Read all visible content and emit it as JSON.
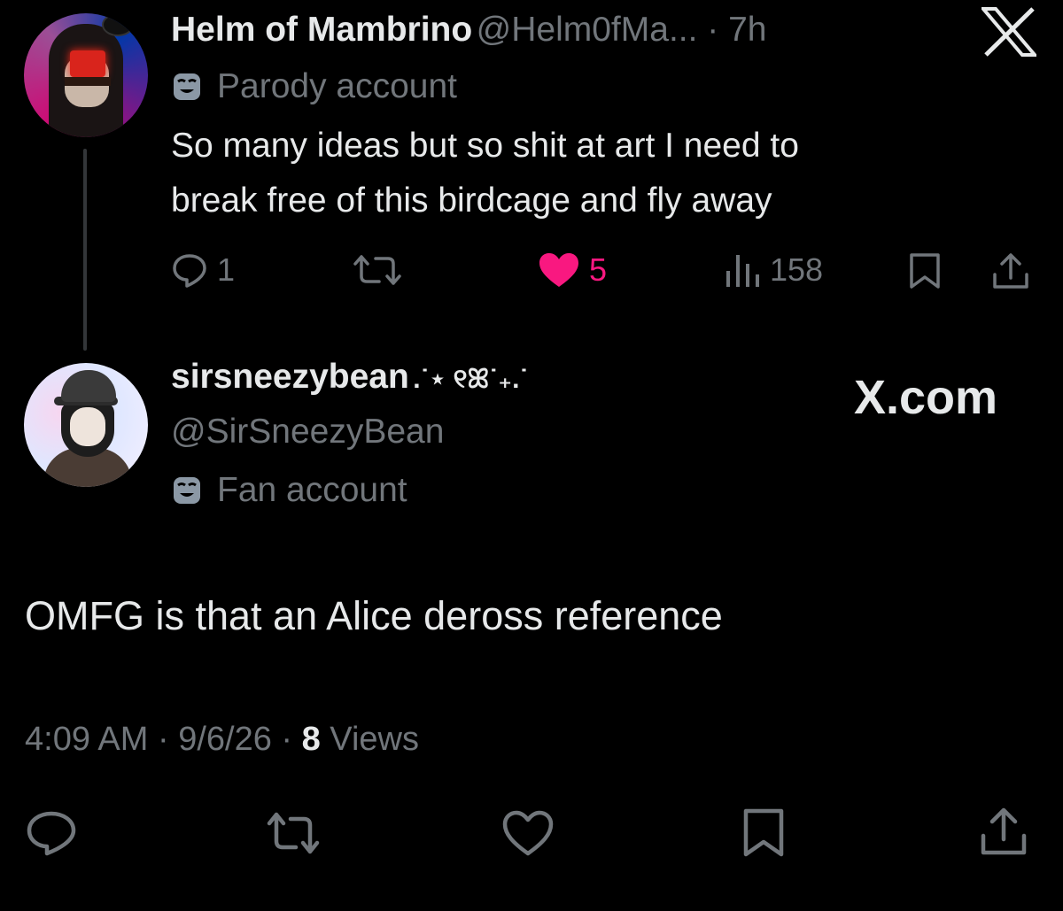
{
  "tweet1": {
    "name": "Helm of Mambrino",
    "handle_time": "@Helm0fMa... · 7h",
    "label": "Parody account",
    "text_line1": "So many ideas but so shit at art I need to",
    "text_line2": "break free of this birdcage and fly away",
    "replies": "1",
    "likes": "5",
    "views": "158"
  },
  "tweet2": {
    "name": "sirsneezybean",
    "name_decor": ".˙⋆ ୧ꕤ˙₊.˙",
    "handle": "@SirSneezyBean",
    "label": "Fan account",
    "text": "OMFG is that an Alice deross reference",
    "time": "4:09 AM · 9/6/26 · ",
    "views_count": "8",
    "views_label": " Views"
  },
  "watermark": {
    "logo": "X",
    "domain": "X.com"
  },
  "icons": [
    "reply-icon",
    "retweet-icon",
    "heart-icon",
    "views-icon",
    "bookmark-icon",
    "share-icon",
    "x-logo-icon",
    "mask-icon"
  ],
  "colors": {
    "background": "#000000",
    "text": "#e7e9ea",
    "muted": "#71767b",
    "like": "#f91880"
  }
}
